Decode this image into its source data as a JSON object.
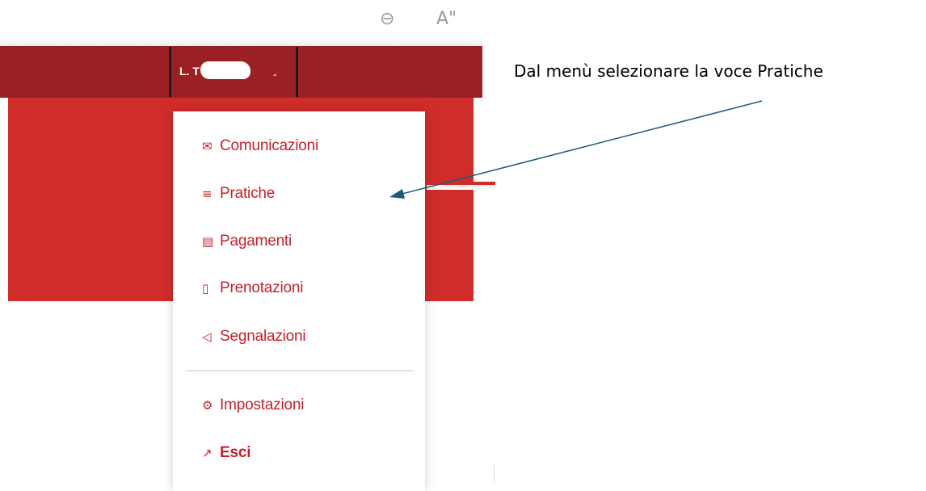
{
  "toolbar": {
    "zoom_icon": "zoom-out-icon",
    "font_icon_label": "A\""
  },
  "header": {
    "user_label": "L. T",
    "caret_icon": "chevron-up-icon"
  },
  "menu": {
    "items": [
      {
        "label": "Comunicazioni",
        "icon": "envelope-icon"
      },
      {
        "label": "Pratiche",
        "icon": "layers-icon"
      },
      {
        "label": "Pagamenti",
        "icon": "document-icon"
      },
      {
        "label": "Prenotazioni",
        "icon": "bookmark-icon"
      },
      {
        "label": "Segnalazioni",
        "icon": "megaphone-icon"
      },
      {
        "label": "Impostazioni",
        "icon": "gear-icon"
      },
      {
        "label": "Esci",
        "icon": "external-link-icon"
      }
    ]
  },
  "annotation": {
    "text": "Dal menù selezionare la voce Pratiche"
  },
  "colors": {
    "header_dark_red": "#9b2024",
    "main_red": "#d02d2a",
    "menu_text_red": "#c8202c",
    "arrow": "#1d5a7a"
  }
}
